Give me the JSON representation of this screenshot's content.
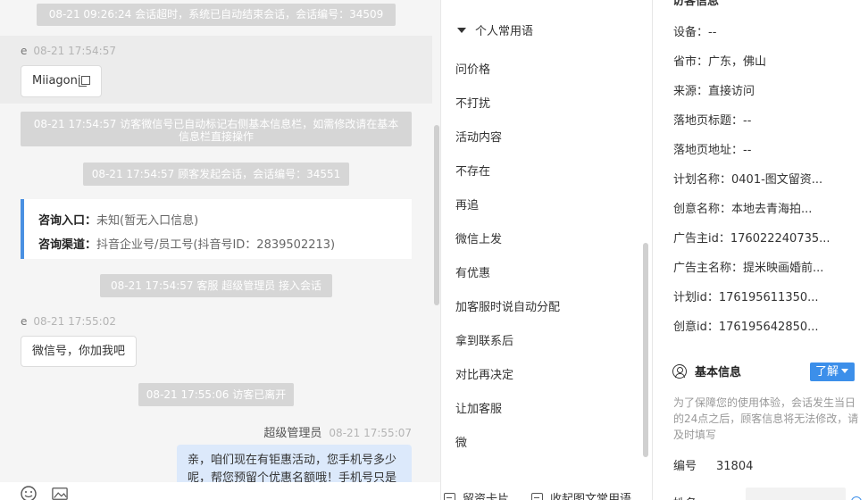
{
  "chat": {
    "sys_timeout": "08-21 09:26:24 会话超时，系统已自动结束会话，会话编号：34509",
    "visitor1_name": "e",
    "visitor1_time": "08-21 17:54:57",
    "visitor1_msg": "Miiagoni",
    "sys_wechat": "08-21 17:54:57 访客微信号已自动标记右侧基本信息栏，如需修改请在基本信息栏直接操作",
    "sys_start": "08-21 17:54:57 顾客发起会话，会话编号：34551",
    "entry_label": "咨询入口：",
    "entry_value": "未知(暂无入口信息)",
    "channel_label": "咨询渠道：",
    "channel_value": "抖音企业号/员工号(抖音号ID：2839502213)",
    "sys_join": "08-21 17:54:57 客服 超级管理员 接入会话",
    "visitor2_name": "e",
    "visitor2_time": "08-21 17:55:02",
    "visitor2_msg": "微信号，你加我吧",
    "sys_leave": "08-21 17:55:06 访客已离开",
    "agent_name": "超级管理员",
    "agent_time": "08-21 17:55:07",
    "agent_msg": "亲，咱们现在有钜惠活动，您手机号多少呢，帮您预留个优惠名额哦！手机号只是"
  },
  "phrases": {
    "header": "个人常用语",
    "items": [
      "问价格",
      "不打扰",
      "活动内容",
      "不存在",
      "再追",
      "微信上发",
      "有优惠",
      "加客服时说自动分配",
      "拿到联系后",
      "对比再决定",
      "让加客服",
      "微"
    ],
    "btn_card": "留资卡片",
    "btn_phrase": "收起图文常用语"
  },
  "info": {
    "top_title": "访客信息",
    "fields": [
      {
        "label": "设备：",
        "value": "--"
      },
      {
        "label": "省市：",
        "value": "广东，佛山"
      },
      {
        "label": "来源：",
        "value": "直接访问"
      },
      {
        "label": "落地页标题：",
        "value": "--"
      },
      {
        "label": "落地页地址：",
        "value": "--"
      },
      {
        "label": "计划名称：",
        "value": "0401-图文留资..."
      },
      {
        "label": "创意名称：",
        "value": "本地去青海拍..."
      },
      {
        "label": "广告主id：",
        "value": "176022240735..."
      },
      {
        "label": "广告主名称：",
        "value": "提米映画婚前..."
      },
      {
        "label": "计划id：",
        "value": "176195611350..."
      },
      {
        "label": "创意id：",
        "value": "176195642850..."
      }
    ],
    "basic_title": "基本信息",
    "learn_label": "了解",
    "note": "为了保障您的使用体验，会话发生当日的24点之后，顾客信息将无法修改，请及时填写",
    "id_label": "编号",
    "id_value": "31804",
    "name_label": "姓名"
  },
  "colors": {
    "accent": "#3c8fea",
    "agent_bubble": "#dce9fb",
    "system_tag": "#d6d6d6"
  }
}
